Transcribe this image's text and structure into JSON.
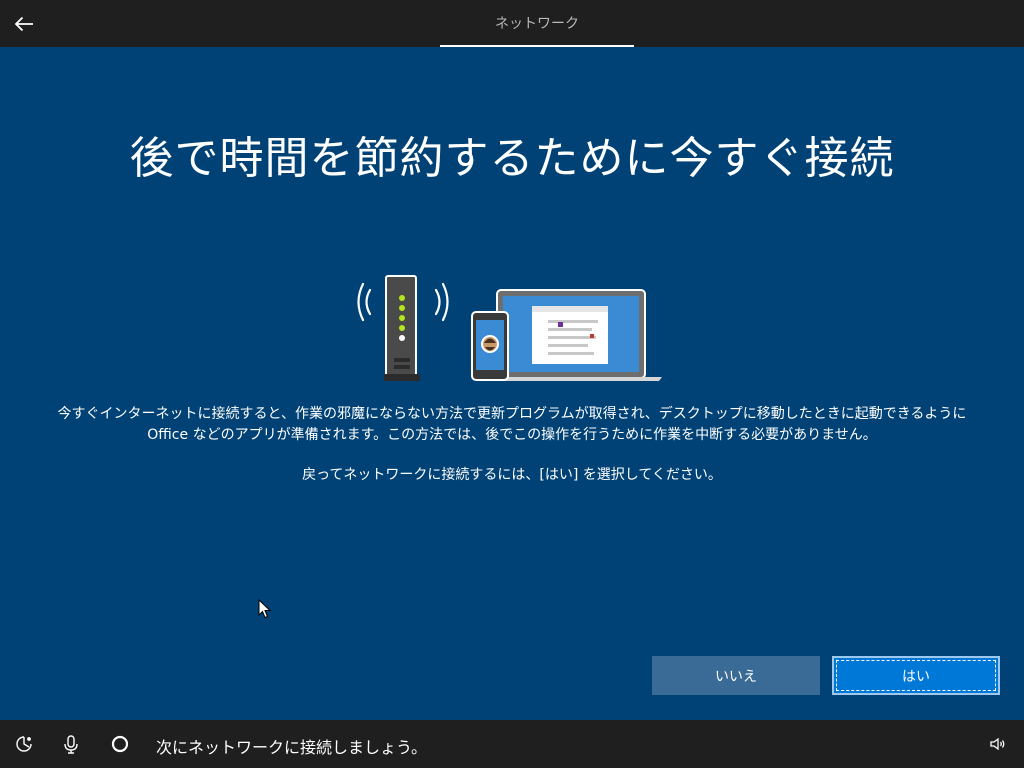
{
  "header": {
    "tab_label": "ネットワーク"
  },
  "main": {
    "title": "後で時間を節約するために今すぐ接続",
    "body": "今すぐインターネットに接続すると、作業の邪魔にならない方法で更新プログラムが取得され、デスクトップに移動したときに起動できるように Office などのアプリが準備されます。この方法では、後でこの操作を行うために作業を中断する必要がありません。",
    "instruction": "戻ってネットワークに接続するには、[はい] を選択してください。",
    "illustration_icon": "router-phone-laptop-illustration"
  },
  "actions": {
    "no_label": "いいえ",
    "yes_label": "はい"
  },
  "bottom_bar": {
    "narrator_text": "次にネットワークに接続しましょう。",
    "icons": [
      "accessibility-icon",
      "microphone-icon",
      "cortana-icon",
      "volume-icon"
    ]
  },
  "colors": {
    "background": "#004275",
    "bar": "#1f1f1f",
    "accent": "#0078d7",
    "secondary_button": "#3a6a96"
  }
}
